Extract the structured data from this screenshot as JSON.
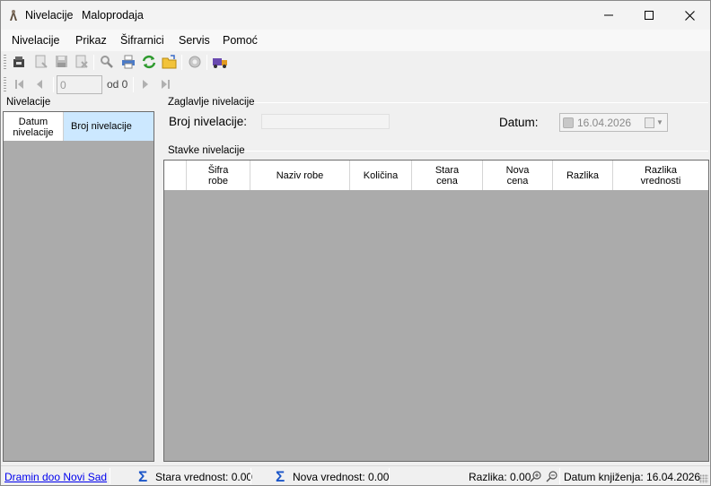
{
  "window": {
    "title": "Nivelacije",
    "subtitle": "Maloprodaja"
  },
  "menu": {
    "items": [
      "Nivelacije",
      "Prikaz",
      "Šifrarnici",
      "Servis",
      "Pomoć"
    ]
  },
  "toolbar": {
    "icons": [
      "new-icon",
      "edit-icon",
      "save-icon",
      "delete-icon",
      "search-icon",
      "print-icon",
      "refresh-icon",
      "open-folder-icon",
      "settings-icon",
      "truck-icon"
    ]
  },
  "navigator": {
    "position_value": "0",
    "of_label": "od 0"
  },
  "left_panel": {
    "label": "Nivelacije",
    "columns": [
      "Datum\nnivelacije",
      "Broj nivelacije"
    ]
  },
  "header_group": {
    "label": "Zaglavlje nivelacije",
    "broj_label": "Broj nivelacije:",
    "broj_value": "",
    "datum_label": "Datum:",
    "datum_value": "16.04.2026"
  },
  "items_group": {
    "label": "Stavke nivelacije",
    "columns": [
      "",
      "Šifra\nrobe",
      "Naziv robe",
      "Količina",
      "Stara\ncena",
      "Nova\ncena",
      "Razlika",
      "Razlika\nvrednosti"
    ]
  },
  "status": {
    "company": "Dramin doo Novi Sad",
    "stara_vrednost": "Stara vrednost: 0.00",
    "nova_vrednost": "Nova vrednost: 0.00",
    "razlika": "Razlika: 0.00",
    "datum_knjizenja": "Datum knjiženja: 16.04.2026"
  },
  "colors": {
    "selected_header": "#cce8ff",
    "grid_background": "#ababab",
    "link": "#0000ee",
    "sigma": "#1a55c8"
  }
}
